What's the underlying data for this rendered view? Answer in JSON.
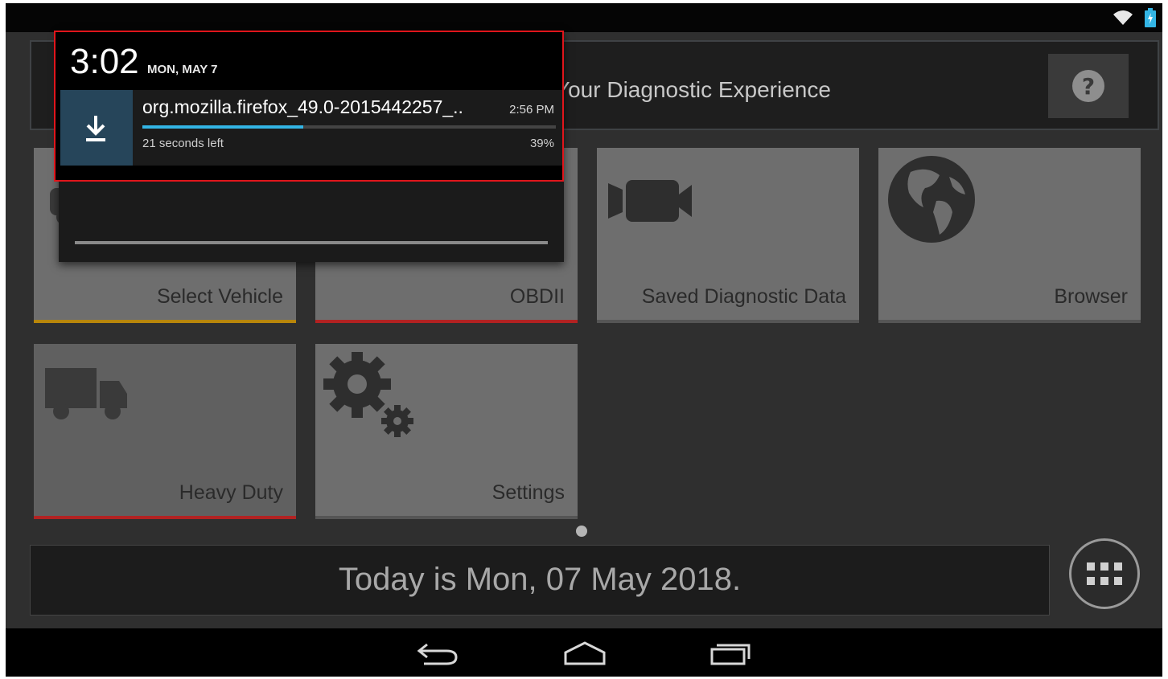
{
  "status_bar": {
    "wifi_icon": "wifi-icon",
    "battery_icon": "battery-charging-icon"
  },
  "header": {
    "title": "Your Diagnostic Experience",
    "help_icon": "help-icon"
  },
  "tiles": [
    {
      "label": "Select Vehicle",
      "icon": "car-icon",
      "accent": "#b8860b"
    },
    {
      "label": "OBDII",
      "icon": "obd-icon",
      "accent": "#b22222"
    },
    {
      "label": "Saved Diagnostic Data",
      "icon": "video-camera-icon",
      "accent": "#555555"
    },
    {
      "label": "Browser",
      "icon": "globe-icon",
      "accent": "#555555"
    },
    {
      "label": "Heavy Duty",
      "icon": "truck-icon",
      "accent": "#b22222"
    },
    {
      "label": "Settings",
      "icon": "gears-icon",
      "accent": "#555555"
    }
  ],
  "footer": {
    "date_text": "Today is Mon, 07 May 2018.",
    "apps_icon": "apps-grid-icon"
  },
  "nav": {
    "back_icon": "back-icon",
    "home_icon": "home-icon",
    "recents_icon": "recents-icon"
  },
  "notification": {
    "clock": "3:02",
    "date": "MON, MAY 7",
    "download": {
      "filename": "org.mozilla.firefox_49.0-2015442257_..",
      "time": "2:56 PM",
      "remaining": "21 seconds left",
      "percent_label": "39%",
      "progress": 0.39,
      "icon": "download-icon"
    }
  }
}
